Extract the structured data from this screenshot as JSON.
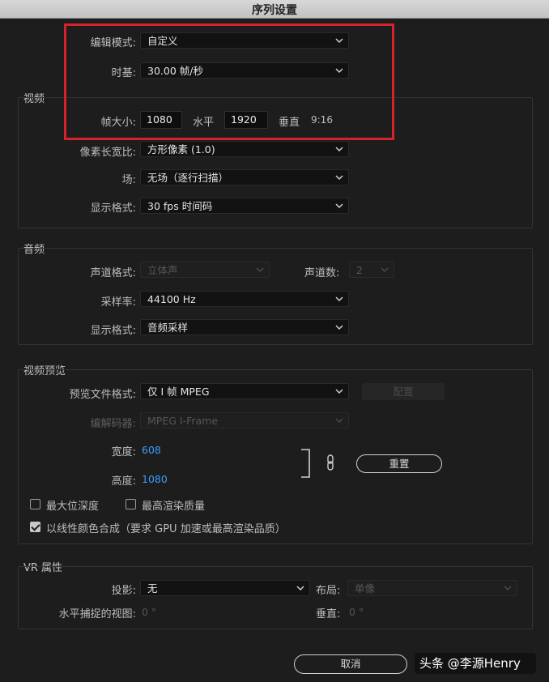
{
  "window": {
    "title": "序列设置"
  },
  "general": {
    "edit_mode_label": "编辑模式:",
    "edit_mode_value": "自定义",
    "timebase_label": "时基:",
    "timebase_value": "30.00  帧/秒"
  },
  "video": {
    "section_title": "视频",
    "frame_size_label": "帧大小:",
    "frame_width": "1080",
    "horizontal_label": "水平",
    "frame_height": "1920",
    "vertical_label": "垂直",
    "aspect": "9:16",
    "pixel_aspect_label": "像素长宽比:",
    "pixel_aspect_value": "方形像素 (1.0)",
    "field_label": "场:",
    "field_value": "无场（逐行扫描）",
    "display_format_label": "显示格式:",
    "display_format_value": "30 fps 时间码"
  },
  "audio": {
    "section_title": "音频",
    "channel_format_label": "声道格式:",
    "channel_format_value": "立体声",
    "channel_count_label": "声道数:",
    "channel_count_value": "2",
    "sample_rate_label": "采样率:",
    "sample_rate_value": "44100 Hz",
    "display_format_label": "显示格式:",
    "display_format_value": "音频采样"
  },
  "preview": {
    "section_title": "视频预览",
    "file_format_label": "预览文件格式:",
    "file_format_value": "仅 I 帧 MPEG",
    "config_button": "配置",
    "codec_label": "编解码器:",
    "codec_value": "MPEG I-Frame",
    "width_label": "宽度:",
    "width_value": "608",
    "height_label": "高度:",
    "height_value": "1080",
    "reset_button": "重置",
    "max_bit_depth": "最大位深度",
    "max_render_quality": "最高渲染质量",
    "linear_color": "以线性颜色合成（要求 GPU 加速或最高渲染品质）"
  },
  "vr": {
    "section_title": "VR 属性",
    "projection_label": "投影:",
    "projection_value": "无",
    "layout_label": "布局:",
    "layout_value": "单像",
    "h_fov_label": "水平捕捉的视图:",
    "h_fov_value": "0 °",
    "v_label": "垂直:",
    "v_value": "0 °"
  },
  "footer": {
    "cancel_button": "取消",
    "watermark": "头条 @李源Henry"
  },
  "colors": {
    "background": "#1d1d1d",
    "highlight_box": "#d6232b",
    "link_value": "#3d9bff"
  }
}
